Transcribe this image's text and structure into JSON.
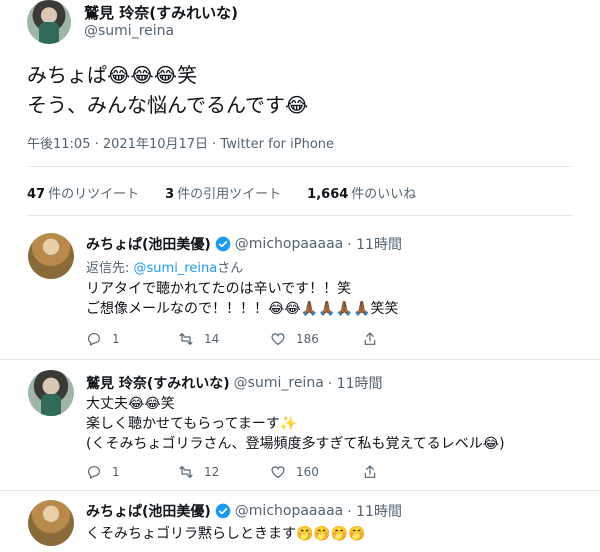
{
  "main_tweet": {
    "author_name": "鷲見 玲奈(すみれいな)",
    "author_handle": "@sumi_reina",
    "text_line1": "みちょぱ😂😂😂笑",
    "text_line2": "そう、みんな悩んでるんです😂",
    "meta": "午後11:05 · 2021年10月17日 · Twitter for iPhone",
    "stats": {
      "retweets_count": "47",
      "retweets_label": "件のリツイート",
      "quotes_count": "3",
      "quotes_label": "件の引用ツイート",
      "likes_count": "1,664",
      "likes_label": "件のいいね"
    }
  },
  "replies": [
    {
      "author_name": "みちょぱ(池田美優)",
      "author_handle": "@michopaaaaa",
      "time": "· 11時間",
      "reply_to_prefix": "返信先: ",
      "reply_to_handle": "@sumi_reina",
      "reply_to_suffix": "さん",
      "text_line1": "リアタイで聴かれてたのは辛いです！！笑",
      "text_line2": "ご想像メールなので！！！！😂😂🙏🏾🙏🏾🙏🏾🙏🏾笑笑",
      "reply_count": "1",
      "retweet_count": "14",
      "like_count": "186"
    },
    {
      "author_name": "鷲見 玲奈(すみれいな)",
      "author_handle": "@sumi_reina",
      "time": "· 11時間",
      "text_line1": "大丈夫😂😂笑",
      "text_line2": "楽しく聴かせてもらってまーす✨",
      "text_line3": "(くそみちょゴリラさん、登場頻度多すぎて私も覚えてるレベル😂)",
      "reply_count": "1",
      "retweet_count": "12",
      "like_count": "160"
    },
    {
      "author_name": "みちょぱ(池田美優)",
      "author_handle": "@michopaaaaa",
      "time": "· 11時間",
      "text_line1": "くそみちょゴリラ黙らしときます🤭🤭🤭🤭"
    }
  ],
  "colors": {
    "text": "#0f1419",
    "secondary": "#536471",
    "link": "#1d9bf0",
    "divider": "#e6e9eb"
  }
}
